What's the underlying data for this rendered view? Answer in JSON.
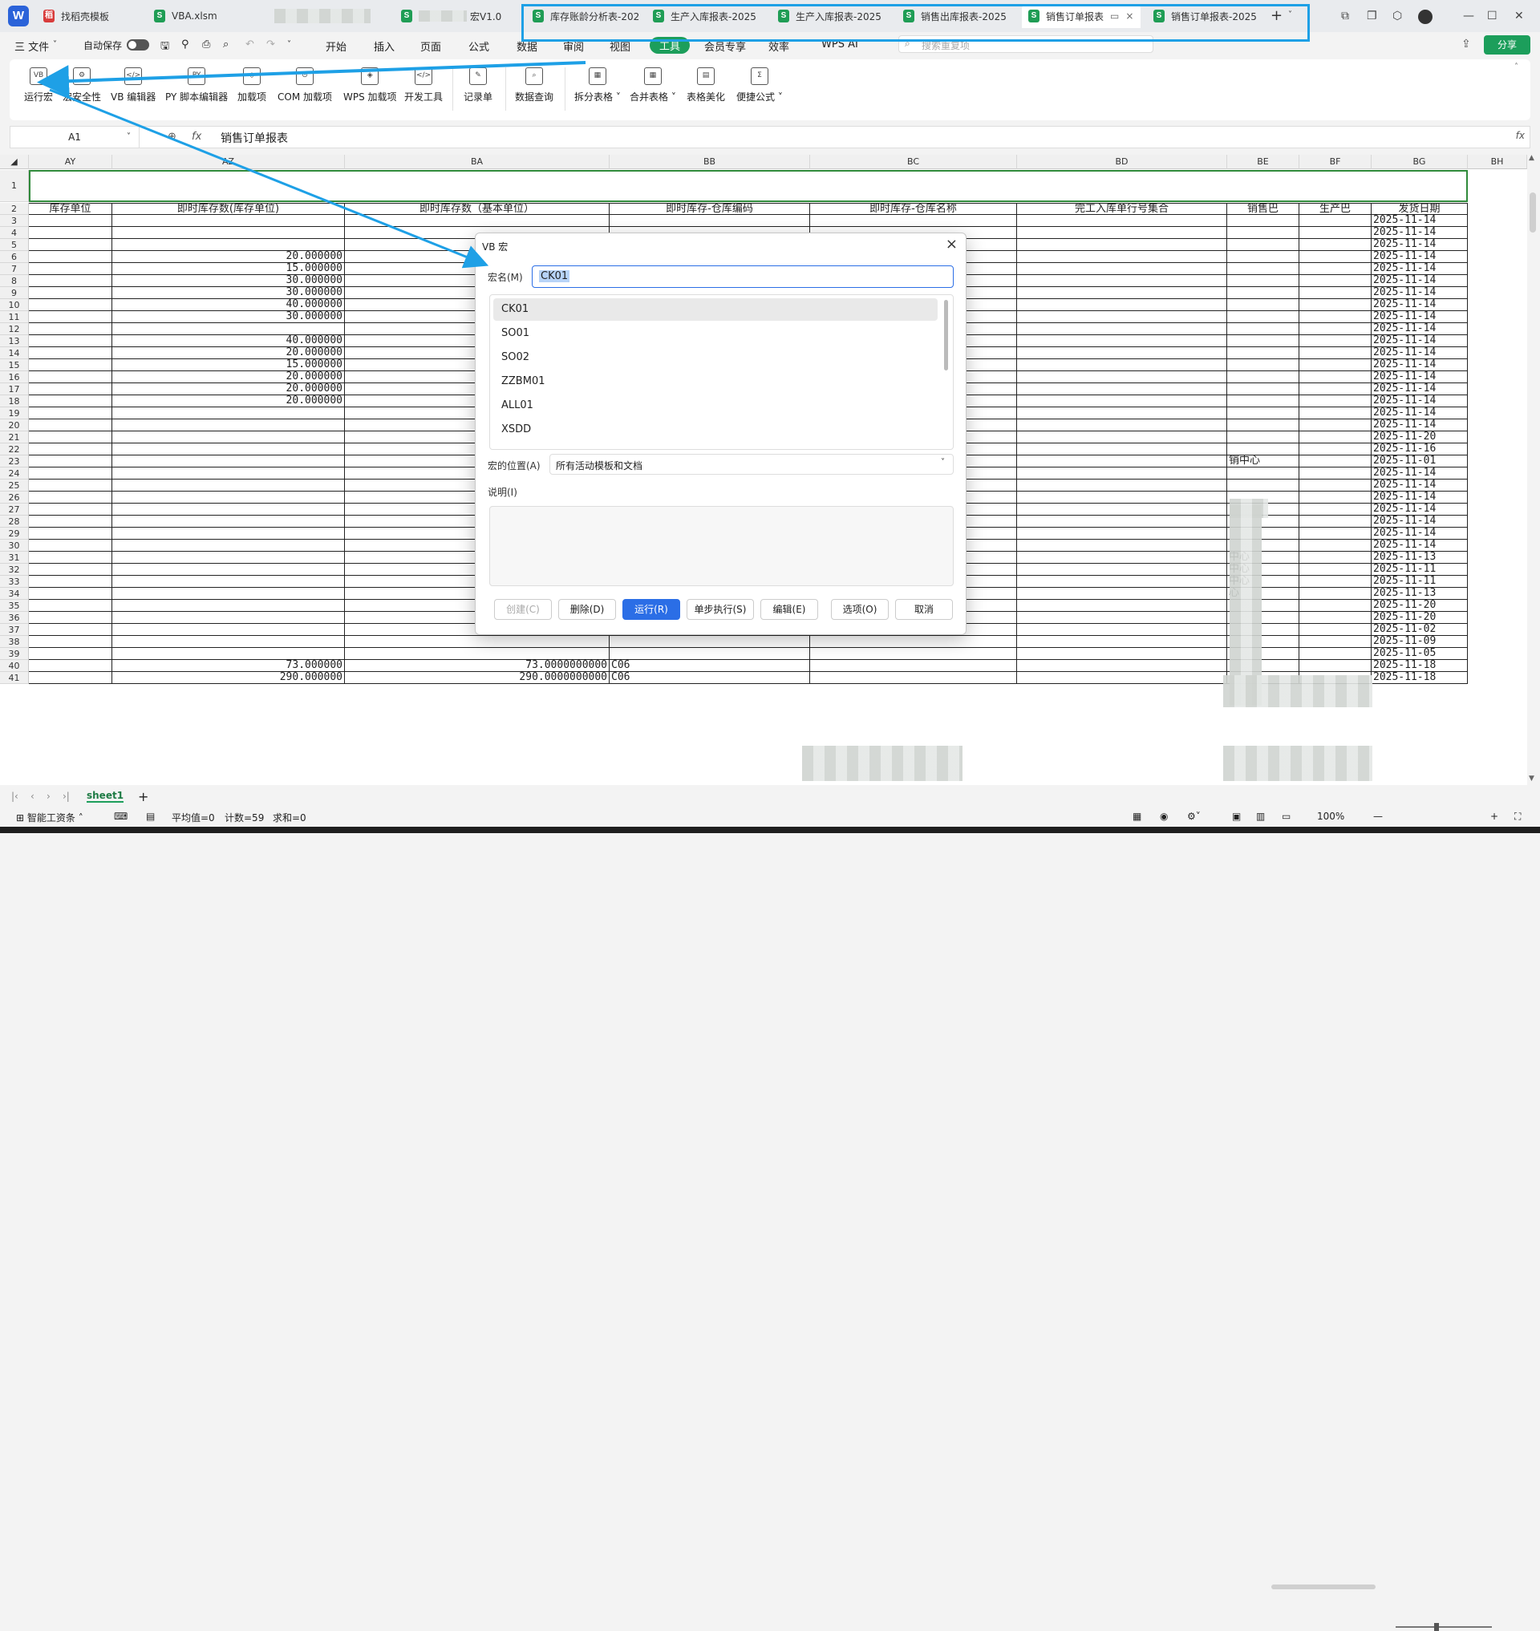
{
  "tabs": [
    {
      "label": "找稻壳模板",
      "type": "r"
    },
    {
      "label": "VBA.xlsm",
      "type": "s"
    },
    {
      "label": "",
      "type": "blur"
    },
    {
      "label": "宏V1.0",
      "type": "s"
    },
    {
      "label": "库存账龄分析表-202",
      "type": "s"
    },
    {
      "label": "生产入库报表-2025",
      "type": "s"
    },
    {
      "label": "生产入库报表-2025",
      "type": "s"
    },
    {
      "label": "销售出库报表-2025",
      "type": "s"
    },
    {
      "label": "销售订单报表",
      "type": "s"
    },
    {
      "label": "销售订单报表-2025",
      "type": "s"
    }
  ],
  "menu": {
    "file": "三 文件",
    "autosave": "自动保存",
    "items": [
      "开始",
      "插入",
      "页面",
      "公式",
      "数据",
      "审阅",
      "视图",
      "工具",
      "会员专享",
      "效率",
      "WPS AI"
    ],
    "active": "工具",
    "search_placeholder": "搜索重复项",
    "share": "分享"
  },
  "ribbon": [
    {
      "label": "运行宏",
      "icon": "VB"
    },
    {
      "label": "宏安全性",
      "icon": "⚙"
    },
    {
      "label": "VB 编辑器",
      "icon": "</>"
    },
    {
      "label": "PY 脚本编辑器",
      "icon": "PY"
    },
    {
      "label": "加载项",
      "icon": "◇"
    },
    {
      "label": "COM 加载项",
      "icon": "⊙"
    },
    {
      "label": "WPS 加载项",
      "icon": "◈"
    },
    {
      "label": "开发工具",
      "icon": "</>"
    },
    {
      "label": "记录单",
      "icon": "✎"
    },
    {
      "label": "数据查询",
      "icon": "⌕"
    },
    {
      "label": "拆分表格 ˅",
      "icon": "▦"
    },
    {
      "label": "合并表格 ˅",
      "icon": "▦"
    },
    {
      "label": "表格美化",
      "icon": "▤"
    },
    {
      "label": "便捷公式 ˅",
      "icon": "Σ"
    }
  ],
  "formula": {
    "cell": "A1",
    "content": "销售订单报表"
  },
  "columns": [
    "AY",
    "AZ",
    "BA",
    "BB",
    "BC",
    "BD",
    "BE",
    "BF",
    "BG",
    "BH"
  ],
  "headers": [
    "库存单位",
    "即时库存数(库存单位)",
    "即时库存数（基本单位）",
    "即时库存-仓库编码",
    "即时库存-仓库名称",
    "完工入库单行号集合",
    "销售巴",
    "生产巴",
    "发货日期"
  ],
  "rows": [
    {
      "n": 3,
      "az": "",
      "ba": "",
      "bb": "",
      "bc": "",
      "be": "",
      "date": "2025-11-14"
    },
    {
      "n": 4,
      "az": "",
      "ba": "",
      "bb": "",
      "bc": "",
      "be": "",
      "date": "2025-11-14"
    },
    {
      "n": 5,
      "az": "",
      "ba": "",
      "bb": "",
      "bc": "",
      "be": "",
      "date": "2025-11-14"
    },
    {
      "n": 6,
      "az": "20.000000",
      "ba": "",
      "bb": "",
      "bc": "",
      "be": "",
      "date": "2025-11-14"
    },
    {
      "n": 7,
      "az": "15.000000",
      "ba": "",
      "bb": "",
      "bc": "",
      "be": "",
      "date": "2025-11-14"
    },
    {
      "n": 8,
      "az": "30.000000",
      "ba": "",
      "bb": "",
      "bc": "",
      "be": "",
      "date": "2025-11-14"
    },
    {
      "n": 9,
      "az": "30.000000",
      "ba": "",
      "bb": "",
      "bc": "",
      "be": "",
      "date": "2025-11-14"
    },
    {
      "n": 10,
      "az": "40.000000",
      "ba": "",
      "bb": "",
      "bc": "",
      "be": "",
      "date": "2025-11-14"
    },
    {
      "n": 11,
      "az": "30.000000",
      "ba": "",
      "bb": "",
      "bc": "",
      "be": "",
      "date": "2025-11-14"
    },
    {
      "n": 12,
      "az": "",
      "ba": "",
      "bb": "",
      "bc": "",
      "be": "",
      "date": "2025-11-14"
    },
    {
      "n": 13,
      "az": "40.000000",
      "ba": "",
      "bb": "",
      "bc": "",
      "be": "",
      "date": "2025-11-14"
    },
    {
      "n": 14,
      "az": "20.000000",
      "ba": "",
      "bb": "",
      "bc": "",
      "be": "",
      "date": "2025-11-14"
    },
    {
      "n": 15,
      "az": "15.000000",
      "ba": "",
      "bb": "",
      "bc": "",
      "be": "",
      "date": "2025-11-14"
    },
    {
      "n": 16,
      "az": "20.000000",
      "ba": "",
      "bb": "",
      "bc": "",
      "be": "",
      "date": "2025-11-14"
    },
    {
      "n": 17,
      "az": "20.000000",
      "ba": "",
      "bb": "",
      "bc": "",
      "be": "",
      "date": "2025-11-14"
    },
    {
      "n": 18,
      "az": "20.000000",
      "ba": "",
      "bb": "",
      "bc": "",
      "be": "",
      "date": "2025-11-14"
    },
    {
      "n": 19,
      "az": "",
      "ba": "",
      "bb": "",
      "bc": "",
      "be": "",
      "date": "2025-11-14"
    },
    {
      "n": 20,
      "az": "",
      "ba": "",
      "bb": "",
      "bc": "",
      "be": "",
      "date": "2025-11-14"
    },
    {
      "n": 21,
      "az": "",
      "ba": "",
      "bb": "",
      "bc": "",
      "be": "",
      "date": "2025-11-20"
    },
    {
      "n": 22,
      "az": "",
      "ba": "",
      "bb": "",
      "bc": "",
      "be": "",
      "date": "2025-11-16"
    },
    {
      "n": 23,
      "az": "",
      "ba": "",
      "bb": "",
      "bc": "",
      "be": "销中心",
      "date": "2025-11-01"
    },
    {
      "n": 24,
      "az": "",
      "ba": "",
      "bb": "",
      "bc": "",
      "be": "",
      "date": "2025-11-14"
    },
    {
      "n": 25,
      "az": "",
      "ba": "",
      "bb": "",
      "bc": "",
      "be": "",
      "date": "2025-11-14"
    },
    {
      "n": 26,
      "az": "",
      "ba": "",
      "bb": "",
      "bc": "",
      "be": "",
      "date": "2025-11-14"
    },
    {
      "n": 27,
      "az": "",
      "ba": "",
      "bb": "",
      "bc": "",
      "be": "",
      "date": "2025-11-14"
    },
    {
      "n": 28,
      "az": "",
      "ba": "",
      "bb": "",
      "bc": "",
      "be": "",
      "date": "2025-11-14"
    },
    {
      "n": 29,
      "az": "",
      "ba": "",
      "bb": "",
      "bc": "",
      "be": "",
      "date": "2025-11-14"
    },
    {
      "n": 30,
      "az": "",
      "ba": "",
      "bb": "",
      "bc": "",
      "be": "",
      "date": "2025-11-14"
    },
    {
      "n": 31,
      "az": "",
      "ba": "",
      "bb": "",
      "bc": "",
      "be": "中心",
      "date": "2025-11-13"
    },
    {
      "n": 32,
      "az": "",
      "ba": "",
      "bb": "",
      "bc": "",
      "be": "中心",
      "date": "2025-11-11"
    },
    {
      "n": 33,
      "az": "",
      "ba": "",
      "bb": "",
      "bc": "",
      "be": "中心",
      "date": "2025-11-11"
    },
    {
      "n": 34,
      "az": "",
      "ba": "",
      "bb": "",
      "bc": "",
      "be": "心",
      "date": "2025-11-13"
    },
    {
      "n": 35,
      "az": "",
      "ba": "",
      "bb": "",
      "bc": "",
      "be": "",
      "date": "2025-11-20"
    },
    {
      "n": 36,
      "az": "",
      "ba": "",
      "bb": "",
      "bc": "",
      "be": "",
      "date": "2025-11-20"
    },
    {
      "n": 37,
      "az": "",
      "ba": "",
      "bb": "",
      "bc": "",
      "be": "",
      "date": "2025-11-02"
    },
    {
      "n": 38,
      "az": "",
      "ba": "",
      "bb": "",
      "bc": "",
      "be": "",
      "date": "2025-11-09"
    },
    {
      "n": 39,
      "az": "",
      "ba": "",
      "bb": "",
      "bc": "",
      "be": "",
      "date": "2025-11-05"
    },
    {
      "n": 40,
      "az": "73.000000",
      "ba": "73.0000000000",
      "bb": "C06",
      "bc": "",
      "be": "",
      "date": "2025-11-18"
    },
    {
      "n": 41,
      "az": "290.000000",
      "ba": "290.0000000000",
      "bb": "C06",
      "bc": "",
      "be": "",
      "date": "2025-11-18"
    }
  ],
  "dialog": {
    "title": "VB 宏",
    "name_label": "宏名(M)",
    "name_value": "CK01",
    "macros": [
      "CK01",
      "SO01",
      "SO02",
      "ZZBM01",
      "ALL01",
      "XSDD"
    ],
    "location_label": "宏的位置(A)",
    "location_value": "所有活动模板和文档",
    "desc_label": "说明(I)",
    "buttons": [
      "创建(C)",
      "删除(D)",
      "运行(R)",
      "单步执行(S)",
      "编辑(E)",
      "选项(O)",
      "取消"
    ]
  },
  "sheet": {
    "name": "sheet1"
  },
  "status": {
    "assistant": "智能工资条",
    "avg": "平均值=0",
    "count": "计数=59",
    "sum": "求和=0",
    "zoom": "100%"
  },
  "colors": {
    "accent": "#1c9e5b",
    "dialog_primary": "#2b6ee6",
    "annotation": "#1ea0e6"
  }
}
